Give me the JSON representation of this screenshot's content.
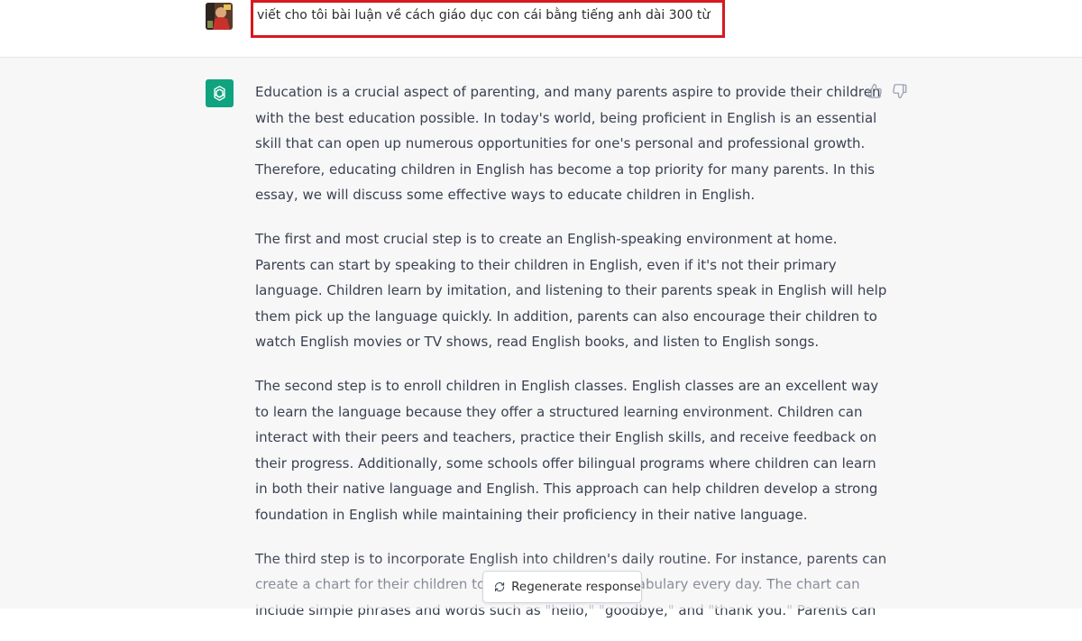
{
  "user_message": {
    "text": "viết cho tôi bài luận về cách giáo dục con cái bằng tiếng anh dài 300 từ"
  },
  "assistant_message": {
    "paragraphs": [
      [
        "Education is a crucial aspect of parenting, and many parents aspire to provide their children",
        "with the best education possible. In today's world, being proficient in English is an essential",
        "skill that can open up numerous opportunities for one's personal and professional growth.",
        "Therefore, educating children in English has become a top priority for many parents. In this",
        "essay, we will discuss some effective ways to educate children in English."
      ],
      [
        "The first and most crucial step is to create an English-speaking environment at home.",
        "Parents can start by speaking to their children in English, even if it's not their primary",
        "language. Children learn by imitation, and listening to their parents speak in English will help",
        "them pick up the language quickly. In addition, parents can also encourage their children to",
        "watch English movies or TV shows, read English books, and listen to English songs."
      ],
      [
        "The second step is to enroll children in English classes. English classes are an excellent way",
        "to learn the language because they offer a structured learning environment. Children can",
        "interact with their peers and teachers, practice their English skills, and receive feedback on",
        "their progress. Additionally, some schools offer bilingual programs where children can learn",
        "in both their native language and English. This approach can help children develop a strong",
        "foundation in English while maintaining their proficiency in their native language."
      ],
      [
        "The third step is to incorporate English into children's daily routine. For instance, parents can",
        "create a chart for their children to learn new English vocabulary every day. The chart can",
        "include simple phrases and words such as \"hello,\" \"goodbye,\" and \"thank you.\" Parents can"
      ]
    ]
  },
  "actions": {
    "regenerate_label": "Regenerate response"
  },
  "icons": {
    "avatar": "user-avatar",
    "assistant": "chatgpt-logo-icon",
    "thumbs_up": "thumbs-up-icon",
    "thumbs_down": "thumbs-down-icon",
    "regenerate": "refresh-icon"
  },
  "colors": {
    "assistant_bg": "#f7f7f8",
    "brand_green": "#10a37f",
    "highlight_border": "#d71920"
  }
}
